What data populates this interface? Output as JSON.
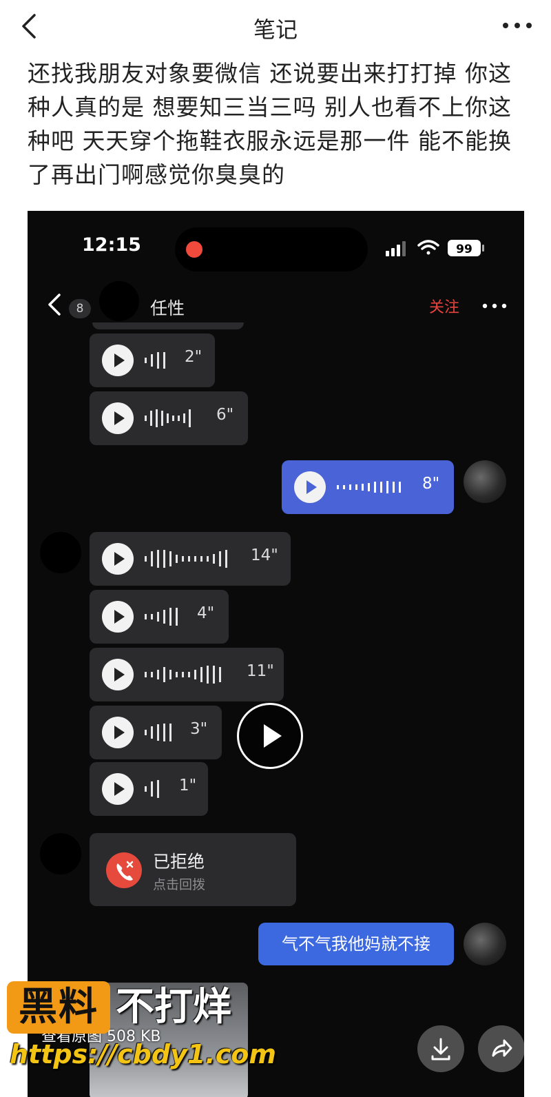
{
  "header": {
    "title": "笔记",
    "back_icon": "chevron-left-icon",
    "more_icon": "more-horizontal-icon"
  },
  "note": {
    "text_lines": [
      "还找我朋友对象要微信 还说要出来打打掉 你这",
      "种人真的是 想要知三当三吗 别人也看不上你这",
      "种吧 天天穿个拖鞋衣服永远是那一件 能不能换",
      "了再出门啊感觉你臭臭的"
    ]
  },
  "screenshot": {
    "status": {
      "time": "12:15",
      "battery": "99",
      "recording_color": "#f04a3c"
    },
    "chat": {
      "unread_count": "8",
      "contact_name": "任性",
      "follow_label": "关注",
      "follow_color": "#e8433c",
      "messages": [
        {
          "from": "other",
          "type": "voice",
          "duration": "2\""
        },
        {
          "from": "other",
          "type": "voice",
          "duration": "6\""
        },
        {
          "from": "me",
          "type": "voice",
          "duration": "8\""
        },
        {
          "from": "other",
          "type": "voice",
          "duration": "14\""
        },
        {
          "from": "other",
          "type": "voice",
          "duration": "4\""
        },
        {
          "from": "other",
          "type": "voice",
          "duration": "11\""
        },
        {
          "from": "other",
          "type": "voice",
          "duration": "3\""
        },
        {
          "from": "other",
          "type": "voice",
          "duration": "1\""
        },
        {
          "from": "other",
          "type": "call",
          "title": "已拒绝",
          "subtitle": "点击回拨"
        },
        {
          "from": "me",
          "type": "text",
          "text": "气不气我他妈就不接"
        }
      ],
      "my_bubble_color": "#4a63d6",
      "my_text_bubble_color": "#3d69e0"
    },
    "image_label": "查看原图 508 KB"
  },
  "actions": {
    "download_icon": "download-icon",
    "share_icon": "share-icon",
    "video_play_icon": "play-icon"
  },
  "watermark": {
    "brand_box": "黑料",
    "brand_side": "不打烊",
    "url": "https://cbdy1.com",
    "brand_color": "#f29a15",
    "url_color": "#f4c414"
  }
}
